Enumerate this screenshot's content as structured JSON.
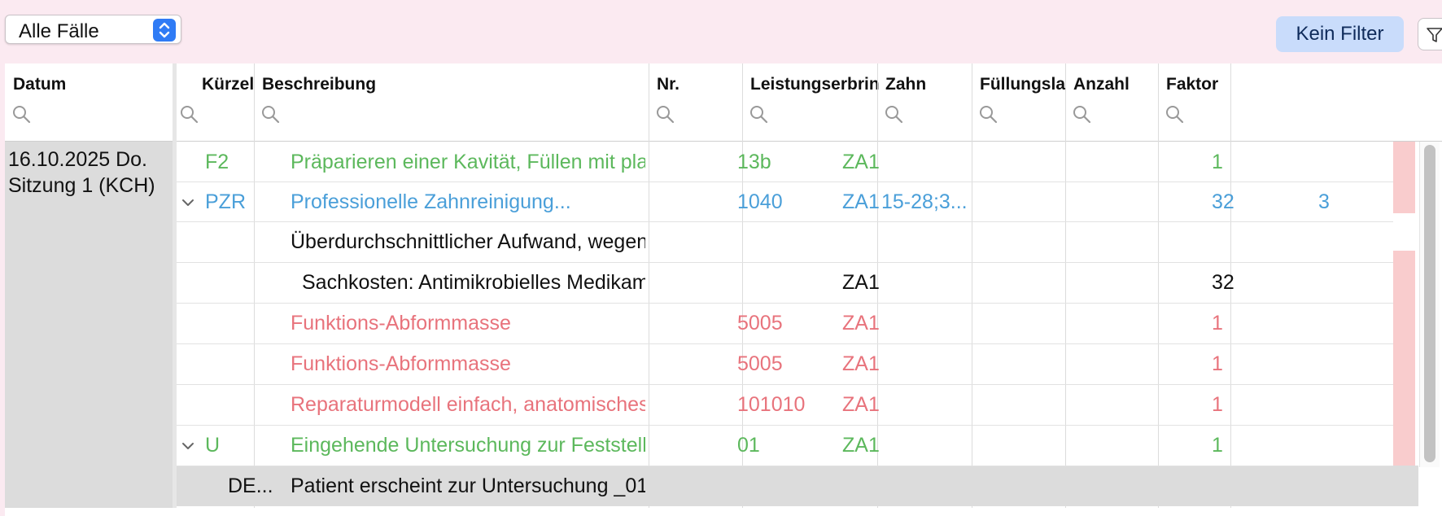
{
  "toolbar": {
    "case_select_value": "Alle Fälle",
    "filter_label": "Kein Filter"
  },
  "colors": {
    "background": "#fbeaf1",
    "green": "#5cb85c",
    "blue": "#4a9fd9",
    "red": "#e8737c",
    "accent": "#2f7bf5"
  },
  "columns": [
    "Datum",
    "Kürzel",
    "Beschreibung",
    "Nr.",
    "Leistungserbrin",
    "Zahn",
    "Füllungsla",
    "Anzahl",
    "Faktor"
  ],
  "session": {
    "date": "16.10.2025 Do.",
    "sitting": "Sitzung 1 (KCH)"
  },
  "rows": [
    {
      "kuerzel": "F2",
      "beschreibung": "Präparieren einer Kavität, Füllen mit plastisc...",
      "nr": "13b",
      "leistungserbringer": "ZA1",
      "zahn": "",
      "fuellungsla": "",
      "anzahl": "1",
      "faktor": "",
      "color": "green"
    },
    {
      "kuerzel": "PZR",
      "beschreibung": "Professionelle Zahnreinigung...",
      "nr": "1040",
      "leistungserbringer": "ZA1",
      "zahn": "15-28;3...",
      "fuellungsla": "",
      "anzahl": "32",
      "faktor": "3",
      "color": "blue"
    },
    {
      "kuerzel": "",
      "beschreibung": "Überdurchschnittlicher Aufwand, wegen au...",
      "nr": "",
      "leistungserbringer": "",
      "zahn": "",
      "fuellungsla": "",
      "anzahl": "",
      "faktor": "",
      "color": "black"
    },
    {
      "kuerzel": "",
      "beschreibung": "Sachkosten: Antimikrobielles Medikament:...",
      "nr": "",
      "leistungserbringer": "ZA1",
      "zahn": "",
      "fuellungsla": "",
      "anzahl": "32",
      "faktor": "",
      "color": "black"
    },
    {
      "kuerzel": "",
      "beschreibung": "Funktions-Abformmasse",
      "nr": "5005",
      "leistungserbringer": "ZA1",
      "zahn": "",
      "fuellungsla": "",
      "anzahl": "1",
      "faktor": "",
      "color": "red"
    },
    {
      "kuerzel": "",
      "beschreibung": "Funktions-Abformmasse",
      "nr": "5005",
      "leistungserbringer": "ZA1",
      "zahn": "",
      "fuellungsla": "",
      "anzahl": "1",
      "faktor": "",
      "color": "red"
    },
    {
      "kuerzel": "",
      "beschreibung": "Reparaturmodell einfach, anatomisches Mo...",
      "nr": "101010",
      "leistungserbringer": "ZA1",
      "zahn": "",
      "fuellungsla": "",
      "anzahl": "1",
      "faktor": "",
      "color": "red"
    },
    {
      "kuerzel": "U",
      "beschreibung": "Eingehende Untersuchung zur Feststellung...",
      "nr": "01",
      "leistungserbringer": "ZA1",
      "zahn": "",
      "fuellungsla": "",
      "anzahl": "1",
      "faktor": "",
      "color": "green"
    },
    {
      "kuerzel": "DE...",
      "beschreibung": "Patient erscheint zur Untersuchung _01",
      "nr": "",
      "leistungserbringer": "",
      "zahn": "",
      "fuellungsla": "",
      "anzahl": "",
      "faktor": "",
      "color": "black"
    }
  ]
}
